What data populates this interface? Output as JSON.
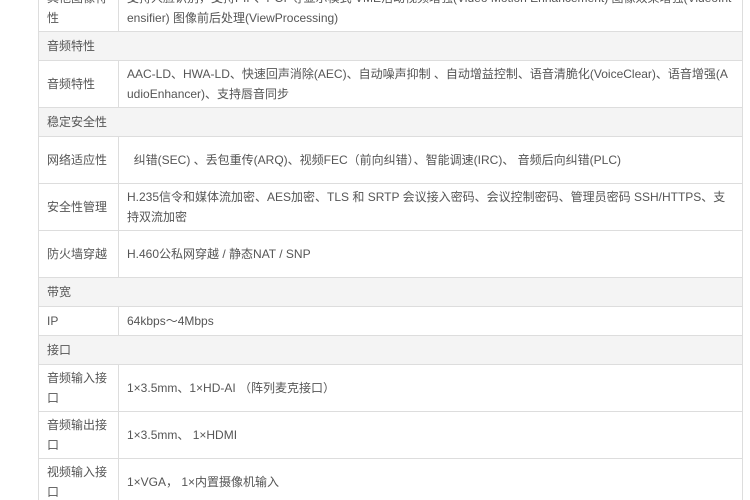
{
  "rows": [
    {
      "label": "其他图像特性",
      "value": "支持人脸识别，支持PIP、POP等显示模式 VME活动视频增强(Video Motion Enhancement) 图像效果增强(VideoIntensifier) 图像前后处理(ViewProcessing)"
    },
    {
      "section": "音频特性"
    },
    {
      "label": "音频特性",
      "value": "AAC-LD、HWA-LD、快速回声消除(AEC)、自动噪声抑制 、自动增益控制、语音清脆化(VoiceClear)、语音增强(AudioEnhancer)、支持唇音同步"
    },
    {
      "section": "稳定安全性"
    },
    {
      "label": "网络适应性",
      "value": "  纠错(SEC) 、丢包重传(ARQ)、视频FEC（前向纠错）、智能调速(IRC)、 音频后向纠错(PLC)"
    },
    {
      "label": "安全性管理",
      "value": "H.235信令和媒体流加密、AES加密、TLS 和 SRTP 会议接入密码、会议控制密码、管理员密码 SSH/HTTPS、支持双流加密"
    },
    {
      "label": "防火墙穿越",
      "value": "H.460公私网穿越 / 静态NAT / SNP"
    },
    {
      "section": "带宽"
    },
    {
      "label": "IP",
      "value": "64kbps～4Mbps"
    },
    {
      "section": "接口"
    },
    {
      "label": "音频输入接口",
      "value": "1×3.5mm、1×HD-AI （阵列麦克接口）"
    },
    {
      "label": "音频输出接口",
      "value": "1×3.5mm、 1×HDMI"
    },
    {
      "label": "视频输入接口",
      "value": "1×VGA， 1×内置摄像机输入"
    }
  ]
}
